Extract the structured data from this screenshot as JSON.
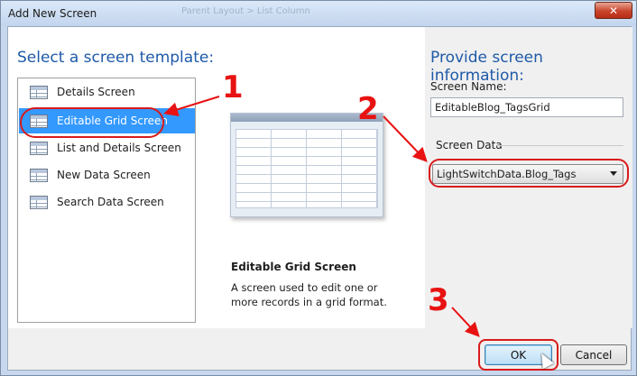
{
  "window": {
    "title": "Add New Screen",
    "close_glyph": "✕",
    "background_caption": "Parent Layout > List Column"
  },
  "left_pane": {
    "heading": "Select a screen template:",
    "templates": [
      {
        "label": "Details Screen",
        "icon": "screen-template-icon",
        "selected": false
      },
      {
        "label": "Editable Grid Screen",
        "icon": "screen-template-icon",
        "selected": true
      },
      {
        "label": "List and Details Screen",
        "icon": "screen-template-icon",
        "selected": false
      },
      {
        "label": "New Data Screen",
        "icon": "screen-template-icon",
        "selected": false
      },
      {
        "label": "Search Data Screen",
        "icon": "screen-template-icon",
        "selected": false
      }
    ],
    "description_title": "Editable Grid Screen",
    "description_body": "A screen used to edit one or more records in a grid format."
  },
  "right_pane": {
    "heading": "Provide screen information:",
    "screen_name_label": "Screen Name:",
    "screen_name_value": "EditableBlog_TagsGrid",
    "screen_data_label": "Screen Data",
    "screen_data_value": "LightSwitchData.Blog_Tags"
  },
  "buttons": {
    "ok_label": "OK",
    "cancel_label": "Cancel"
  },
  "annotations": {
    "step1": "1",
    "step2": "2",
    "step3": "3",
    "color": "#e81212"
  }
}
